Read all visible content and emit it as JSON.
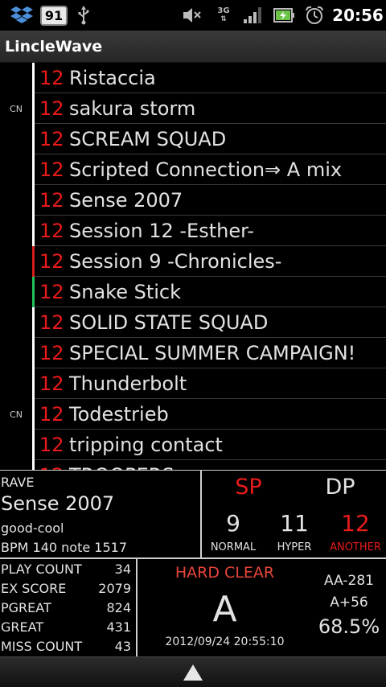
{
  "status_bar": {
    "notification_count": "91",
    "network_label": "3G",
    "time": "20:56"
  },
  "app": {
    "title": "LincleWave"
  },
  "songs": [
    {
      "tag": "",
      "level": "12",
      "name": "Ristaccia",
      "strip_color": "#ffffff"
    },
    {
      "tag": "CN",
      "level": "12",
      "name": "sakura storm",
      "strip_color": "#ffffff"
    },
    {
      "tag": "",
      "level": "12",
      "name": "SCREAM SQUAD",
      "strip_color": "#ffffff"
    },
    {
      "tag": "",
      "level": "12",
      "name": "Scripted Connection⇒ A mix",
      "strip_color": "#ffffff"
    },
    {
      "tag": "",
      "level": "12",
      "name": "Sense 2007",
      "strip_color": "#ffffff"
    },
    {
      "tag": "",
      "level": "12",
      "name": "Session 12 -Esther-",
      "strip_color": "#ffffff"
    },
    {
      "tag": "",
      "level": "12",
      "name": "Session 9 -Chronicles-",
      "strip_color": "#d41c1c"
    },
    {
      "tag": "",
      "level": "12",
      "name": "Snake Stick",
      "strip_color": "#22c35a"
    },
    {
      "tag": "",
      "level": "12",
      "name": "SOLID STATE SQUAD",
      "strip_color": "#ffffff"
    },
    {
      "tag": "",
      "level": "12",
      "name": "SPECIAL SUMMER CAMPAIGN!",
      "strip_color": "#ffffff"
    },
    {
      "tag": "",
      "level": "12",
      "name": "Thunderbolt",
      "strip_color": "#ffffff"
    },
    {
      "tag": "CN",
      "level": "12",
      "name": "Todestrieb",
      "strip_color": "#ffffff"
    },
    {
      "tag": "",
      "level": "12",
      "name": "tripping contact",
      "strip_color": "#ffffff"
    },
    {
      "tag": "",
      "level": "12",
      "name": "TROOPERS",
      "strip_color": "#ffffff"
    }
  ],
  "detail": {
    "genre": "RAVE",
    "title": "Sense 2007",
    "artist": "good-cool",
    "bpm_note": "BPM 140  note 1517",
    "sp_label": "SP",
    "dp_label": "DP",
    "difficulties": [
      {
        "value": "9",
        "label": "NORMAL"
      },
      {
        "value": "11",
        "label": "HYPER"
      },
      {
        "value": "12",
        "label": "ANOTHER"
      }
    ],
    "stats": [
      {
        "label": "PLAY COUNT",
        "value": "34"
      },
      {
        "label": "EX SCORE",
        "value": "2079"
      },
      {
        "label": "PGREAT",
        "value": "824"
      },
      {
        "label": "GREAT",
        "value": "431"
      },
      {
        "label": "MISS COUNT",
        "value": "43"
      }
    ],
    "clear_lamp": "HARD CLEAR",
    "grade": "A",
    "date": "2012/09/24 20:55:10",
    "rank_diff_1": "AA-281",
    "rank_diff_2": "A+56",
    "rate": "68.5%"
  },
  "colors": {
    "accent_red": "#e81a1a",
    "text": "#e2e2e2",
    "divider": "#cfcfcf"
  }
}
